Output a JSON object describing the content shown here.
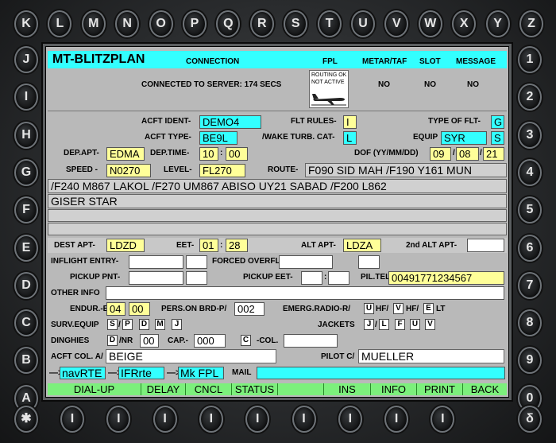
{
  "keys": {
    "top": [
      "K",
      "L",
      "M",
      "N",
      "O",
      "P",
      "Q",
      "R",
      "S",
      "T",
      "U",
      "V",
      "W",
      "X",
      "Y",
      "Z"
    ],
    "left": [
      "J",
      "I",
      "H",
      "G",
      "F",
      "E",
      "D",
      "C",
      "B",
      "A"
    ],
    "right": [
      "1",
      "2",
      "3",
      "4",
      "5",
      "6",
      "7",
      "8",
      "9",
      "0"
    ],
    "bottom_left": "✱",
    "bottom_right": "δ",
    "bottom_soft": "I"
  },
  "header": {
    "title": "MT-BLITZPLAN",
    "connection_label": "CONNECTION",
    "fpl_label": "FPL",
    "metar_label": "METAR/TAF",
    "slot_label": "SLOT",
    "message_label": "MESSAGE",
    "status_text": "CONNECTED TO SERVER: 174 SECS",
    "routing_line1": "ROUTING OK",
    "routing_line2": "NOT ACTIVE",
    "metar_value": "NO",
    "slot_value": "NO",
    "message_value": "NO"
  },
  "form": {
    "acft_ident_label": "ACFT IDENT-",
    "acft_ident": "DEMO4",
    "flt_rules_label": "FLT RULES-",
    "flt_rules": "I",
    "type_of_flt_label": "TYPE OF FLT-",
    "type_of_flt": "G",
    "acft_type_label": "ACFT TYPE-",
    "acft_type": "BE9L",
    "wake_label": "/WAKE TURB. CAT-",
    "wake": "L",
    "equip_label": "EQUIP",
    "equip": "SYR",
    "equip_suffix": "S",
    "dep_apt_label": "DEP.APT-",
    "dep_apt": "EDMA",
    "dep_time_label": "DEP.TIME-",
    "dep_time_hh": "10",
    "dep_time_mm": "00",
    "dof_label": "DOF (YY/MM/DD)",
    "dof_yy": "09",
    "dof_mm": "08",
    "dof_dd": "21",
    "speed_label": "SPEED -",
    "speed": "N0270",
    "level_label": "LEVEL-",
    "level": "FL270",
    "route_label": "ROUTE-",
    "route_line1": "F090 SID MAH /F190 Y161 MUN",
    "route_line2": "/F240 M867 LAKOL /F270 UM867 ABISO UY21 SABAD /F200 L862",
    "route_line3": "GISER STAR",
    "dest_apt_label": "DEST APT-",
    "dest_apt": "LDZD",
    "eet_label": "EET-",
    "eet_hh": "01",
    "eet_mm": "28",
    "alt_apt_label": "ALT APT-",
    "alt_apt": "LDZA",
    "alt2_label": "2nd ALT APT-",
    "inflight_label": "INFLIGHT ENTRY-",
    "forced_label": "FORCED OVERFLY-",
    "pickup_pnt_label": "PICKUP PNT-",
    "pickup_eet_label": "PICKUP EET-",
    "pil_tel_label": "PIL.TEL",
    "pil_tel": "00491771234567",
    "other_info_label": "OTHER INFO",
    "endur_label": "ENDUR.-E/",
    "endur_hh": "04",
    "endur_mm": "00",
    "pers_label": "PERS.ON BRD-P/",
    "pers": "002",
    "emerg_label": "EMERG.RADIO-R/",
    "emerg_u": "U",
    "emerg_hf1": "HF/",
    "emerg_v": "V",
    "emerg_hf2": "HF/",
    "emerg_e": "E",
    "emerg_lt": "LT",
    "surv_label": "SURV.EQUIP",
    "surv_s": "S",
    "surv_p": "P",
    "surv_d": "D",
    "surv_m": "M",
    "surv_j": "J",
    "jackets_label": "JACKETS",
    "jackets_j": "J",
    "jackets_l": "L",
    "jackets_f": "F",
    "jackets_u": "U",
    "jackets_v": "V",
    "dinghies_label": "DINGHIES",
    "dinghies_d": "D",
    "nr_label": "/NR",
    "nr": "00",
    "cap_label": "CAP.-",
    "cap": "000",
    "col_c": "C",
    "col_label": "-COL.",
    "acft_col_label": "ACFT COL. A/",
    "acft_col": "BEIGE",
    "pilot_label": "PILOT C/",
    "pilot": "MUELLER"
  },
  "nav": {
    "navrte": "navRTE",
    "ifrrte": "IFRrte",
    "mkfpl": "Mk FPL",
    "mail_label": "MAIL"
  },
  "bottom": [
    "DIAL-UP",
    "DELAY",
    "CNCL",
    "STATUS",
    "",
    "INS",
    "INFO",
    "PRINT",
    "BACK"
  ]
}
